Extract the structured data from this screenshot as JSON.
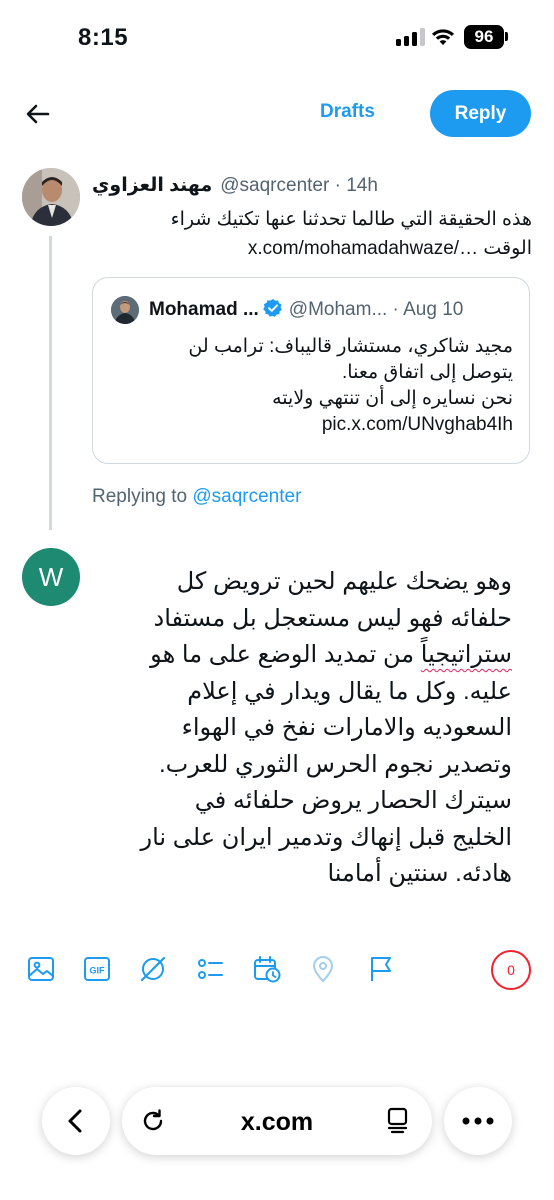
{
  "status_bar": {
    "time": "8:15",
    "battery": "96",
    "icons": [
      "signal-icon",
      "wifi-icon",
      "battery-icon"
    ]
  },
  "top_bar": {
    "back_icon": "arrow-left-icon",
    "drafts_label": "Drafts",
    "reply_label": "Reply",
    "accent_color": "#1d9bf0"
  },
  "original_tweet": {
    "author_name": "مهند العزاوي",
    "handle": "@saqrcenter",
    "separator": " · ",
    "time": "14h",
    "text_line1": "هذه الحقيقة التي طالما تحدثنا عنها تكتيك شراء",
    "text_line2": "الوقت",
    "link": "x.com/mohamadahwaze/…",
    "quoted": {
      "author_name": "Mohamad ...",
      "handle": "@Moham...",
      "separator": " · ",
      "date": "Aug 10",
      "text_line1": "مجيد شاكري، مستشار قاليباف: ترامب لن",
      "text_line2": "يتوصل إلى اتفاق معنا.",
      "text_line3": "نحن نسايره إلى أن تنتهي ولايته",
      "link": "pic.x.com/UNvghab4Ih"
    }
  },
  "replying_to": {
    "prefix": "Replying to",
    "handle": "@saqrcenter"
  },
  "composer": {
    "avatar_letter": "W",
    "avatar_color": "#1e8a72",
    "lines": [
      "وهو يضحك عليهم لحين ترويض كل",
      "حلفائه فهو ليس مستعجل بل مستفاد",
      "استراتيجياً من تمديد الوضع على ما هو",
      "عليه. وكل ما يقال ويدار في إعلام",
      "السعوديه والامارات نفخ في الهواء",
      "وتصدير نجوم الحرس الثوري للعرب.",
      "سيترك الحصار يروض حلفائه في",
      "الخليج قبل إنهاك وتدمير ايران على نار",
      "هادئه. سنتين أمامنا"
    ],
    "misspelled_word": "ستراتيجياً",
    "line3_rest": " من تمديد الوضع على ما هو"
  },
  "toolbar": {
    "icons": [
      "image-icon",
      "gif-icon",
      "grok-icon",
      "poll-icon",
      "schedule-icon",
      "location-icon",
      "flag-icon"
    ],
    "gif_label": "GIF",
    "char_count": "0",
    "over_limit_color": "#f4212e"
  },
  "safari": {
    "url": "x.com",
    "icons": [
      "chevron-left-icon",
      "reload-icon",
      "reader-icon",
      "more-icon"
    ]
  }
}
